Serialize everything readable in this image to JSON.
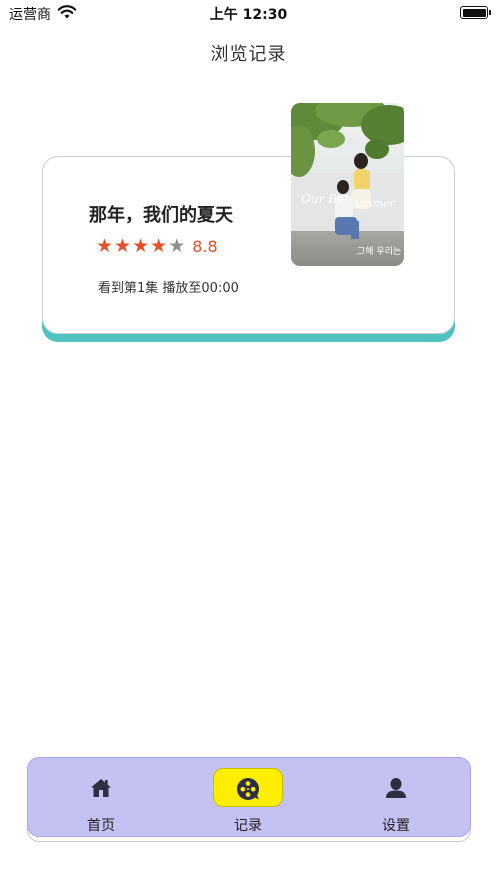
{
  "status_bar": {
    "carrier": "运营商",
    "time": "上午 12:30"
  },
  "nav": {
    "title": "浏览记录"
  },
  "record": {
    "title": "那年，我们的夏天",
    "rating": "8.8",
    "stars_filled": 4,
    "stars_total": 5,
    "progress": "看到第1集  播放至00:00",
    "accent_color": "#4fc3bf",
    "rating_color": "#e8502a"
  },
  "tabbar": {
    "background": "#c4c1f3",
    "active_highlight": "#ffee00",
    "tabs": [
      {
        "label": "首页",
        "icon": "home-icon"
      },
      {
        "label": "记录",
        "icon": "film-reel-icon"
      },
      {
        "label": "设置",
        "icon": "user-icon"
      }
    ]
  }
}
